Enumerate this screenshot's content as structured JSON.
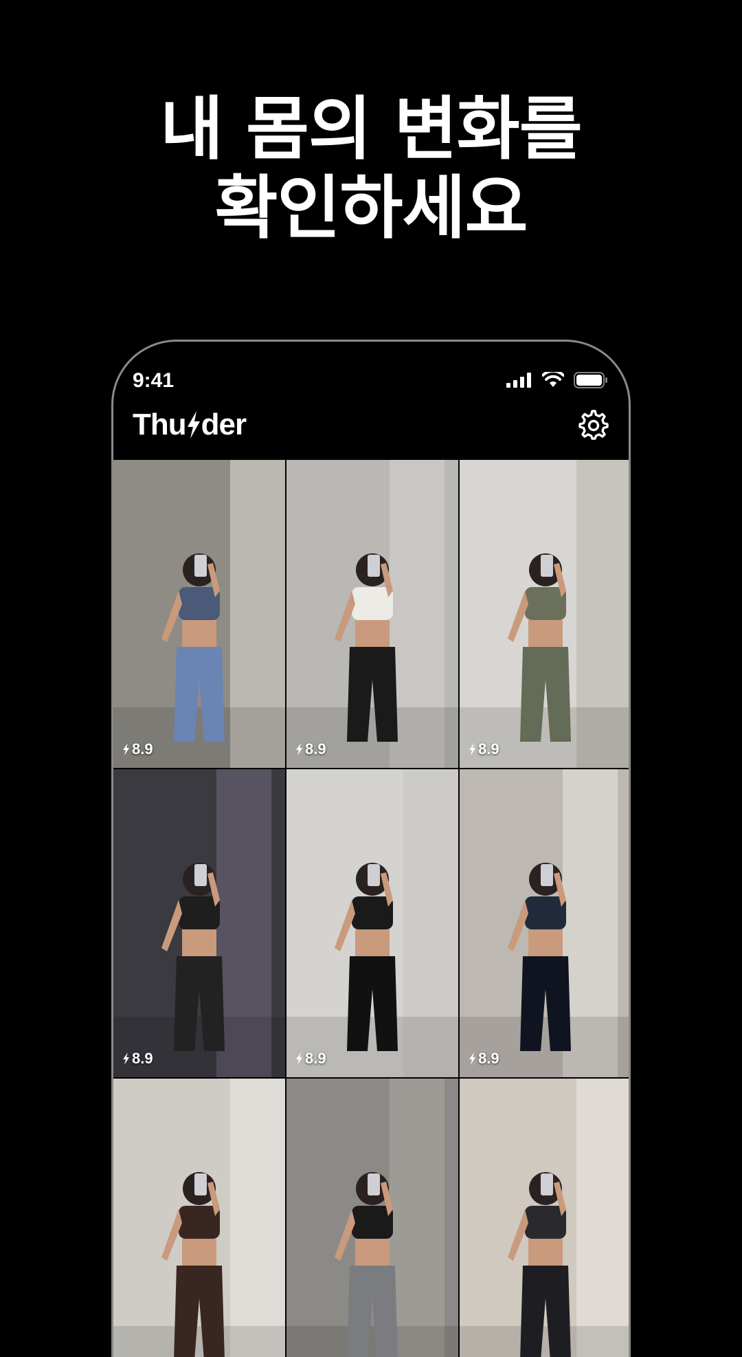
{
  "headline": {
    "line1": "내 몸의 변화를",
    "line2": "확인하세요"
  },
  "status_bar": {
    "time": "9:41",
    "icons": [
      "cellular-signal-icon",
      "wifi-icon",
      "battery-icon"
    ]
  },
  "app": {
    "logo_left": "Thu",
    "logo_right": "der",
    "logo_icon": "lightning-bolt-icon",
    "settings_icon": "gear-icon"
  },
  "grid": {
    "tiles": [
      {
        "score": "8.9",
        "bg": "#8f8c86",
        "wall": "#d9d6cf",
        "top": "#4a5a78",
        "bottom": "#6a84b4"
      },
      {
        "score": "8.9",
        "bg": "#b9b8b4",
        "wall": "#d2d1cd",
        "top": "#ecebe6",
        "bottom": "#1a1a1a"
      },
      {
        "score": "8.9",
        "bg": "#d8d6d2",
        "wall": "#bcb8b0",
        "top": "#6b705c",
        "bottom": "#646b56"
      },
      {
        "score": "8.9",
        "bg": "#3a3a40",
        "wall": "#6b6478",
        "top": "#1e1e1e",
        "bottom": "#222222"
      },
      {
        "score": "8.9",
        "bg": "#d4d3d0",
        "wall": "#c7c6c2",
        "top": "#1a1a1a",
        "bottom": "#111111"
      },
      {
        "score": "8.9",
        "bg": "#bdb8b2",
        "wall": "#e4e2de",
        "top": "#202a3a",
        "bottom": "#0f1420"
      },
      {
        "score": "",
        "bg": "#cfccc6",
        "wall": "#e8e6e1",
        "top": "#3a2620",
        "bottom": "#3a2620"
      },
      {
        "score": "",
        "bg": "#8c8a86",
        "wall": "#a8a6a2",
        "top": "#1a1a1a",
        "bottom": "#7a7c80"
      },
      {
        "score": "",
        "bg": "#cfc9c0",
        "wall": "#e9e6e0",
        "top": "#2a2a2e",
        "bottom": "#1e1e22"
      }
    ]
  },
  "colors": {
    "background": "#000000",
    "text": "#ffffff",
    "phone_border": "#8a8a8a",
    "skin": "#c99a7c"
  }
}
